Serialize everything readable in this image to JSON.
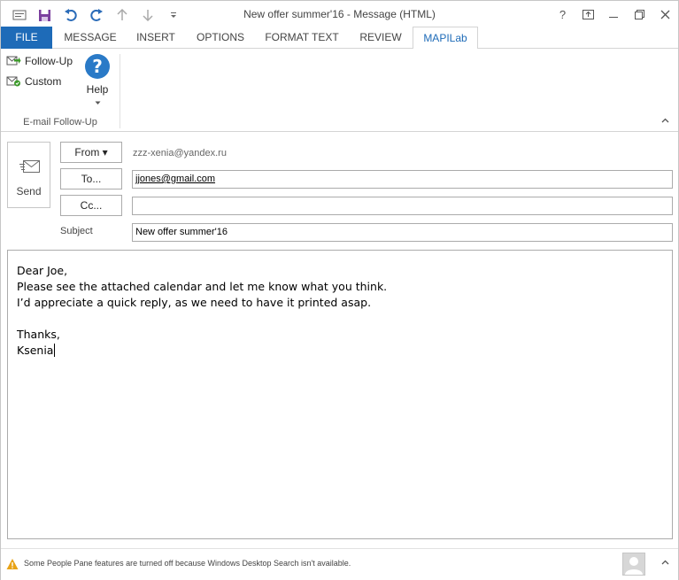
{
  "window": {
    "title": "New offer summer'16 - Message (HTML)",
    "controls": {
      "help": "?"
    }
  },
  "ribbon_tabs": [
    {
      "label": "FILE"
    },
    {
      "label": "MESSAGE"
    },
    {
      "label": "INSERT"
    },
    {
      "label": "OPTIONS"
    },
    {
      "label": "FORMAT TEXT"
    },
    {
      "label": "REVIEW"
    },
    {
      "label": "MAPILab"
    }
  ],
  "ribbon": {
    "follow_up_label": "Follow-Up",
    "custom_label": "Custom",
    "help_label": "Help",
    "help_glyph": "?",
    "group_label": "E-mail Follow-Up"
  },
  "compose": {
    "send_label": "Send",
    "from_label": "From ▾",
    "from_address": "zzz-xenia@yandex.ru",
    "to_label": "To...",
    "to_value": "jjones@gmail.com",
    "cc_label": "Cc...",
    "cc_value": "",
    "subject_label": "Subject",
    "subject_value": "New offer summer'16",
    "body_lines": [
      "Dear Joe,",
      "Please see the attached calendar and let me know what you think.",
      "I’d appreciate a quick reply, as we need to have it printed asap.",
      "",
      "Thanks,",
      "Ksenia"
    ]
  },
  "status": {
    "message": "Some People Pane features are turned off because Windows Desktop Search isn't available."
  },
  "colors": {
    "accent": "#1e6bb8",
    "help_icon": "#2a7ac7",
    "warning": "#e8a317"
  }
}
